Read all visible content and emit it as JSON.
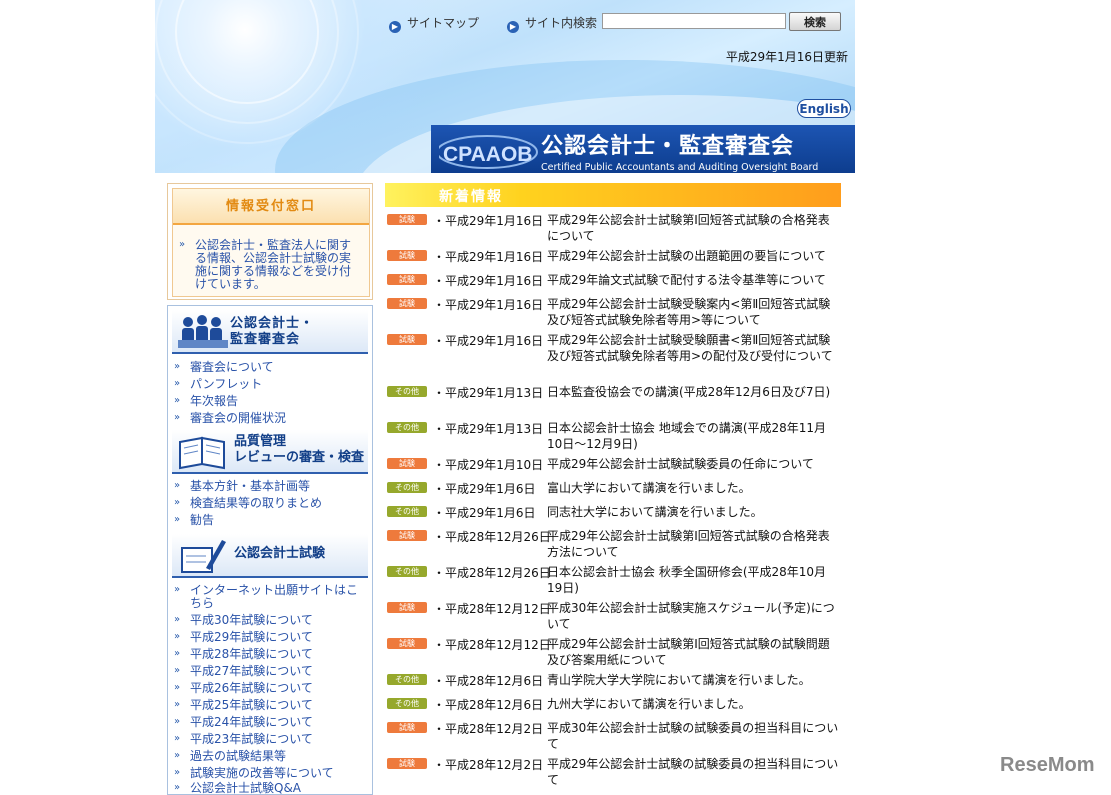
{
  "header": {
    "sitemap_label": "サイトマップ",
    "search_label": "サイト内検索",
    "search_input_value": "",
    "search_button_label": "検索",
    "update_date": "平成29年1月16日更新",
    "english_label": "English",
    "logo_text": "CPAAOB",
    "site_title": "公認会計士・監査審査会",
    "site_subtitle": "Certified Public Accountants and Auditing Oversight Board"
  },
  "sidebar": {
    "info_box": {
      "title": "情報受付窓口",
      "text": "公認会計士・監査法人に関する情報、公認会計士試験の実施に関する情報などを受け付けています。"
    },
    "sections": [
      {
        "title_lines": [
          "公認会計士・",
          "監査審査会"
        ],
        "links": [
          "審査会について",
          "パンフレット",
          "年次報告",
          "審査会の開催状況"
        ]
      },
      {
        "title_lines": [
          "品質管理",
          "レビューの審査・検査"
        ],
        "links": [
          "基本方針・基本計画等",
          "検査結果等の取りまとめ",
          "勧告"
        ]
      },
      {
        "title_lines": [
          "公認会計士試験"
        ],
        "links": [
          "インターネット出願サイトはこちら",
          "平成30年試験について",
          "平成29年試験について",
          "平成28年試験について",
          "平成27年試験について",
          "平成26年試験について",
          "平成25年試験について",
          "平成24年試験について",
          "平成23年試験について",
          "過去の試験結果等",
          "試験実施の改善等について",
          "公認会計士試験Q&A"
        ]
      }
    ]
  },
  "news": {
    "title": "新着情報",
    "badge_exam": "試験",
    "badge_other": "その他",
    "items": [
      {
        "type": "exam",
        "date": "・平成29年1月16日",
        "text": "平成29年公認会計士試験第Ⅰ回短答式試験の合格発表について"
      },
      {
        "type": "exam",
        "date": "・平成29年1月16日",
        "text": "平成29年公認会計士試験の出題範囲の要旨について"
      },
      {
        "type": "exam",
        "date": "・平成29年1月16日",
        "text": "平成29年論文式試験で配付する法令基準等について"
      },
      {
        "type": "exam",
        "date": "・平成29年1月16日",
        "text": "平成29年公認会計士試験受験案内<第Ⅱ回短答式試験及び短答式試験免除者等用>等について"
      },
      {
        "type": "exam",
        "date": "・平成29年1月16日",
        "text": "平成29年公認会計士試験受験願書<第Ⅱ回短答式試験及び短答式試験免除者等用>の配付及び受付について"
      },
      {
        "type": "other",
        "date": "・平成29年1月13日",
        "text": "日本監査役協会での講演(平成28年12月6日及び7日)"
      },
      {
        "type": "other",
        "date": "・平成29年1月13日",
        "text": "日本公認会計士協会 地域会での講演(平成28年11月10日～12月9日)"
      },
      {
        "type": "exam",
        "date": "・平成29年1月10日",
        "text": "平成29年公認会計士試験試験委員の任命について"
      },
      {
        "type": "other",
        "date": "・平成29年1月6日",
        "text": "富山大学において講演を行いました。"
      },
      {
        "type": "other",
        "date": "・平成29年1月6日",
        "text": "同志社大学において講演を行いました。"
      },
      {
        "type": "exam",
        "date": "・平成28年12月26日",
        "text": "平成29年公認会計士試験第Ⅰ回短答式試験の合格発表方法について"
      },
      {
        "type": "other",
        "date": "・平成28年12月26日",
        "text": "日本公認会計士協会 秋季全国研修会(平成28年10月19日)"
      },
      {
        "type": "exam",
        "date": "・平成28年12月12日",
        "text": "平成30年公認会計士試験実施スケジュール(予定)について"
      },
      {
        "type": "exam",
        "date": "・平成28年12月12日",
        "text": "平成29年公認会計士試験第Ⅰ回短答式試験の試験問題及び答案用紙について"
      },
      {
        "type": "other",
        "date": "・平成28年12月6日",
        "text": "青山学院大学大学院において講演を行いました。"
      },
      {
        "type": "other",
        "date": "・平成28年12月6日",
        "text": "九州大学において講演を行いました。"
      },
      {
        "type": "exam",
        "date": "・平成28年12月2日",
        "text": "平成30年公認会計士試験の試験委員の担当科目について"
      },
      {
        "type": "exam",
        "date": "・平成28年12月2日",
        "text": "平成29年公認会計士試験の試験委員の担当科目について"
      }
    ]
  },
  "watermark": "ReseMom",
  "colors": {
    "title_bar": "#1d55b3",
    "link": "#2952a8",
    "badge_exam": "#ee7a3c",
    "badge_other": "#96a82c",
    "news_header": "#ff9d1c"
  }
}
